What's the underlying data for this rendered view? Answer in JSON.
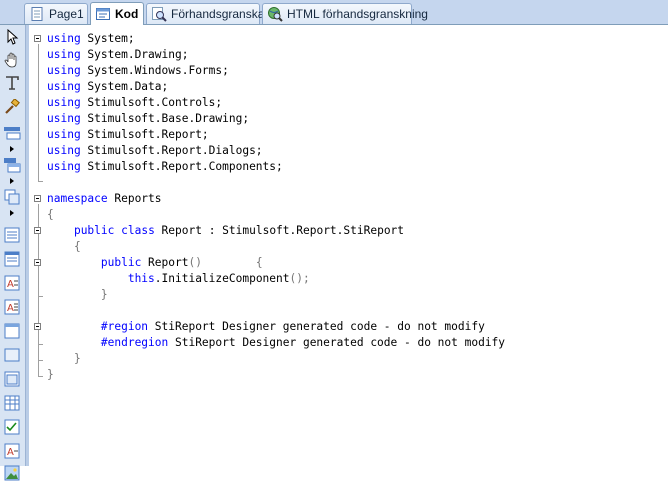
{
  "tabs": [
    {
      "label": "Page1",
      "icon": "page-icon",
      "active": false
    },
    {
      "label": "Kod",
      "icon": "code-icon",
      "active": true
    },
    {
      "label": "Förhandsgranska",
      "icon": "preview-magnifier-icon",
      "active": false
    },
    {
      "label": "HTML förhandsgranskning",
      "icon": "html-preview-globe-icon",
      "active": false
    }
  ],
  "toolbox": {
    "tools": [
      "select-pointer-icon",
      "hand-pan-icon",
      "text-tool-icon",
      "format-painter-icon",
      "band-tool-icon",
      "cross-band-icon",
      "subreport-icon",
      "page-header-icon",
      "data-band-icon",
      "text-component-icon",
      "rich-text-icon",
      "panel-icon",
      "shape-icon",
      "table-icon",
      "check-box-icon",
      "checked-list-icon",
      "text-box-icon",
      "image-icon"
    ]
  },
  "code": {
    "lines": [
      [
        {
          "t": "using",
          "c": "kw"
        },
        {
          "t": " System;"
        }
      ],
      [
        {
          "t": "using",
          "c": "kw"
        },
        {
          "t": " System.Drawing;"
        }
      ],
      [
        {
          "t": "using",
          "c": "kw"
        },
        {
          "t": " System.Windows.Forms;"
        }
      ],
      [
        {
          "t": "using",
          "c": "kw"
        },
        {
          "t": " System.Data;"
        }
      ],
      [
        {
          "t": "using",
          "c": "kw"
        },
        {
          "t": " Stimulsoft.Controls;"
        }
      ],
      [
        {
          "t": "using",
          "c": "kw"
        },
        {
          "t": " Stimulsoft.Base.Drawing;"
        }
      ],
      [
        {
          "t": "using",
          "c": "kw"
        },
        {
          "t": " Stimulsoft.Report;"
        }
      ],
      [
        {
          "t": "using",
          "c": "kw"
        },
        {
          "t": " Stimulsoft.Report.Dialogs;"
        }
      ],
      [
        {
          "t": "using",
          "c": "kw"
        },
        {
          "t": " Stimulsoft.Report.Components;"
        }
      ],
      [
        {
          "t": ""
        }
      ],
      [
        {
          "t": "namespace",
          "c": "kw"
        },
        {
          "t": " Reports"
        }
      ],
      [
        {
          "t": "{",
          "c": "pu"
        }
      ],
      [
        {
          "t": "    "
        },
        {
          "t": "public",
          "c": "kw"
        },
        {
          "t": " "
        },
        {
          "t": "class",
          "c": "kw"
        },
        {
          "t": " Report : Stimulsoft.Report.StiReport"
        }
      ],
      [
        {
          "t": "    "
        },
        {
          "t": "{",
          "c": "pu"
        }
      ],
      [
        {
          "t": "        "
        },
        {
          "t": "public",
          "c": "kw"
        },
        {
          "t": " Report"
        },
        {
          "t": "()",
          "c": "pu"
        },
        {
          "t": "        "
        },
        {
          "t": "{",
          "c": "pu"
        }
      ],
      [
        {
          "t": "            "
        },
        {
          "t": "this",
          "c": "kw"
        },
        {
          "t": ".InitializeComponent"
        },
        {
          "t": "();",
          "c": "pu"
        }
      ],
      [
        {
          "t": "        "
        },
        {
          "t": "}",
          "c": "pu"
        }
      ],
      [
        {
          "t": ""
        }
      ],
      [
        {
          "t": "        "
        },
        {
          "t": "#region",
          "c": "kw"
        },
        {
          "t": " StiReport Designer generated code - do not modify"
        }
      ],
      [
        {
          "t": "        "
        },
        {
          "t": "#endregion",
          "c": "kw"
        },
        {
          "t": " StiReport Designer generated code - do not modify"
        }
      ],
      [
        {
          "t": "    "
        },
        {
          "t": "}",
          "c": "pu"
        }
      ],
      [
        {
          "t": "}",
          "c": "pu"
        }
      ]
    ]
  }
}
